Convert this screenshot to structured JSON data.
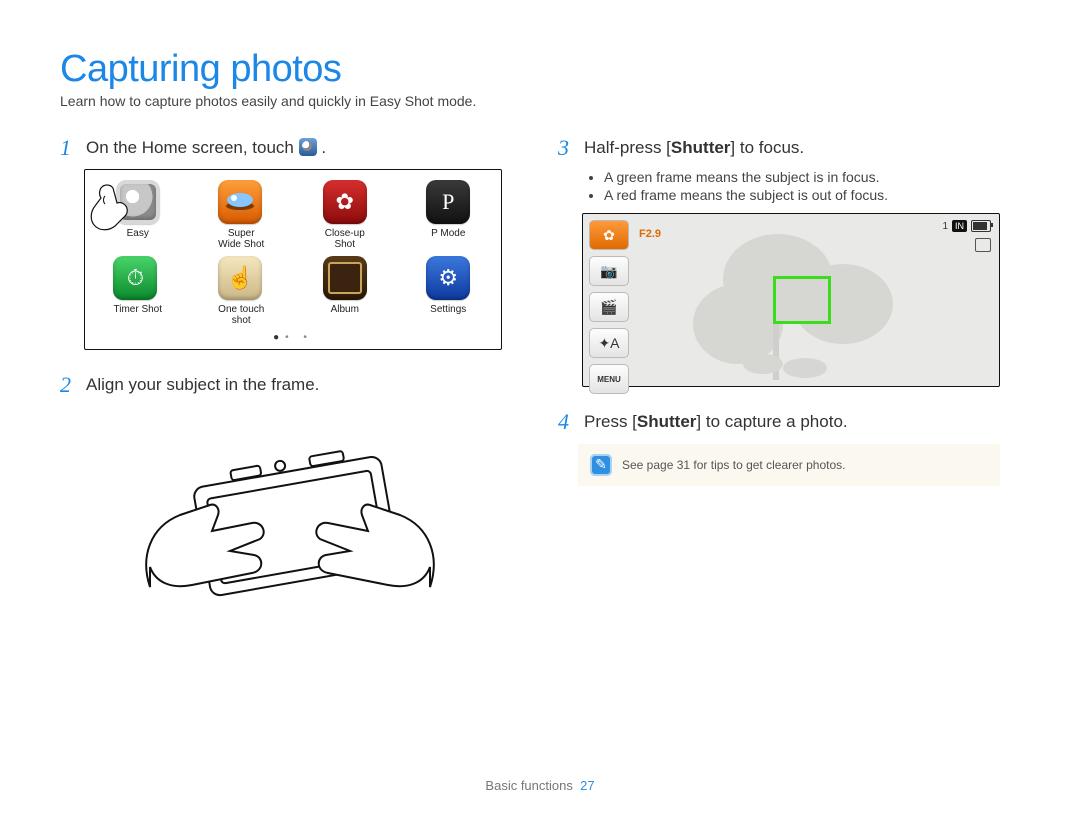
{
  "title": "Capturing photos",
  "intro": "Learn how to capture photos easily and quickly in Easy Shot mode.",
  "steps": {
    "s1": {
      "num": "1",
      "text_pre": "On the Home screen, touch ",
      "text_post": "."
    },
    "s2": {
      "num": "2",
      "text": "Align your subject in the frame."
    },
    "s3": {
      "num": "3",
      "text_pre": "Half-press [",
      "bold": "Shutter",
      "text_post": "] to focus.",
      "bullets": [
        "A green frame means the subject is in focus.",
        "A red frame means the subject is out of focus."
      ]
    },
    "s4": {
      "num": "4",
      "text_pre": "Press [",
      "bold": "Shutter",
      "text_post": "] to capture a photo."
    }
  },
  "home_icons": [
    {
      "label": "Easy",
      "kind": "ic-easy",
      "glyph": ""
    },
    {
      "label": "Super\nWide Shot",
      "kind": "ic-super",
      "glyph": ""
    },
    {
      "label": "Close-up\nShot",
      "kind": "ic-close",
      "glyph": "✿"
    },
    {
      "label": "P Mode",
      "kind": "ic-pmode",
      "glyph": "P"
    },
    {
      "label": "Timer Shot",
      "kind": "ic-timer",
      "glyph": "⏱"
    },
    {
      "label": "One touch\nshot",
      "kind": "ic-onetouch",
      "glyph": "☝"
    },
    {
      "label": "Album",
      "kind": "ic-album",
      "glyph": ""
    },
    {
      "label": "Settings",
      "kind": "ic-sett",
      "glyph": "⚙"
    }
  ],
  "lcd": {
    "fnumber": "F2.9",
    "counter": "1",
    "chip": "IN",
    "sidebar": [
      {
        "glyph": "✿",
        "name": "macro-icon",
        "orange": true
      },
      {
        "glyph": "📷",
        "name": "photo-mode-icon",
        "orange": false
      },
      {
        "glyph": "🎬",
        "name": "video-mode-icon",
        "orange": false
      },
      {
        "glyph": "✦A",
        "name": "auto-flash-icon",
        "orange": false
      },
      {
        "glyph": "MENU",
        "name": "menu-button",
        "orange": false,
        "small": true
      }
    ]
  },
  "note": "See page 31 for tips to get clearer photos.",
  "footer": {
    "section": "Basic functions",
    "page": "27"
  }
}
